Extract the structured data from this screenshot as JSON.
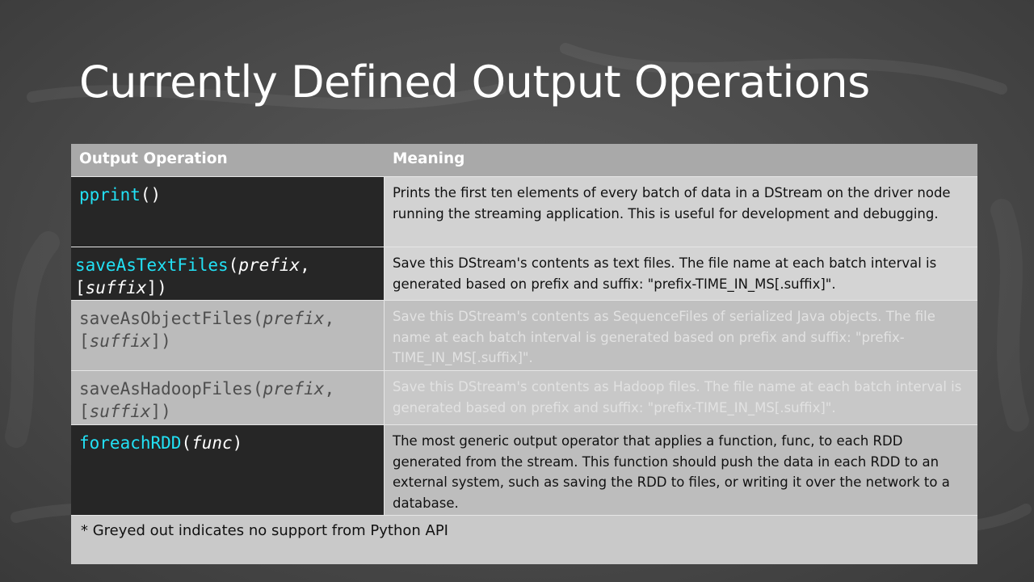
{
  "slide": {
    "title": "Currently Defined Output Operations"
  },
  "table": {
    "header": {
      "op": "Output Operation",
      "meaning": "Meaning"
    },
    "rows": [
      {
        "fn": "pprint",
        "open": "()",
        "arg1": "",
        "sep": "",
        "arg2": "",
        "close": "",
        "meaning": "Prints the first ten elements of every batch of data in a DStream on the driver node running the streaming application. This is useful for development and debugging.",
        "greyed": false
      },
      {
        "fn": "saveAsTextFiles",
        "open": "(",
        "arg1": "prefix",
        "sep": ", [",
        "arg2": "suffix",
        "close": "])",
        "meaning": "Save this DStream's contents as text files. The file name at each batch interval is generated based on prefix and suffix: \"prefix-TIME_IN_MS[.suffix]\".",
        "greyed": false
      },
      {
        "fn": "saveAsObjectFiles",
        "open": "(",
        "arg1": "prefix",
        "sep": ", [",
        "arg2": "suffix",
        "close": "])",
        "meaning": "Save this DStream's contents as SequenceFiles of serialized Java objects. The file name at each batch interval is generated based on prefix and suffix: \"prefix-TIME_IN_MS[.suffix]\".",
        "greyed": true
      },
      {
        "fn": "saveAsHadoopFiles",
        "open": "(",
        "arg1": "prefix",
        "sep": ", [",
        "arg2": "suffix",
        "close": "])",
        "meaning": "Save this DStream's contents as Hadoop files. The file name at each batch interval is generated based on prefix and suffix: \"prefix-TIME_IN_MS[.suffix]\".",
        "greyed": true
      },
      {
        "fn": "foreachRDD",
        "open": "(",
        "arg1": "func",
        "sep": "",
        "arg2": "",
        "close": ")",
        "meaning": "The most generic output operator that applies a function, func, to each RDD generated from the stream. This function should push the data in each RDD to an external system, such as saving the RDD to files, or writing it over the network to a database.",
        "greyed": false
      }
    ],
    "footnote": "* Greyed out indicates no support from Python API"
  },
  "colors": {
    "background": "#4a4a4a",
    "header": "#a9a9a9",
    "code_cell": "#262626",
    "function_name": "#22e1f5",
    "greyed_text": "#e2e2e2"
  }
}
